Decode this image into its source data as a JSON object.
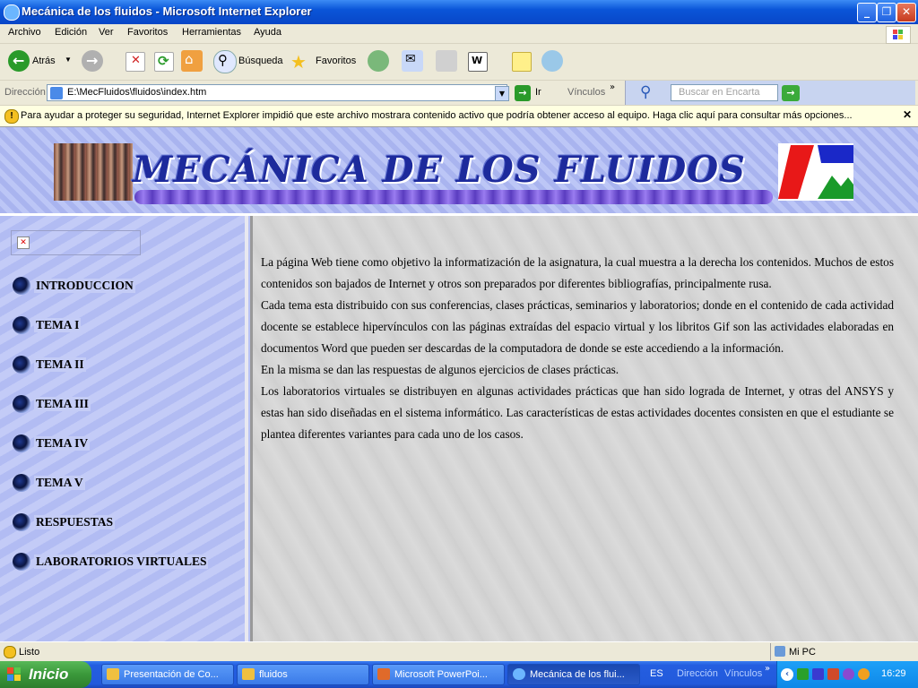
{
  "window": {
    "title": "Mecánica de los fluidos - Microsoft Internet Explorer"
  },
  "menu": [
    "Archivo",
    "Edición",
    "Ver",
    "Favoritos",
    "Herramientas",
    "Ayuda"
  ],
  "toolbar": {
    "back": "Atrás",
    "search": "Búsqueda",
    "favorites": "Favoritos"
  },
  "address": {
    "label": "Dirección",
    "value": "E:\\MecFluidos\\fluidos\\index.htm",
    "go": "Ir",
    "links": "Vínculos",
    "search_placeholder": "Buscar en Encarta"
  },
  "infobar": {
    "text": "Para ayudar a proteger su seguridad, Internet Explorer impidió que este archivo mostrara contenido activo que podría obtener acceso al equipo. Haga clic aquí para consultar más opciones..."
  },
  "banner": {
    "title": "MECÁNICA DE LOS FLUIDOS"
  },
  "nav": [
    "INTRODUCCION",
    "TEMA I",
    "TEMA II",
    "TEMA III",
    "TEMA IV",
    "TEMA V",
    "RESPUESTAS",
    "LABORATORIOS VIRTUALES"
  ],
  "content": {
    "paragraphs": [
      "La página Web tiene como objetivo la informatización de la asignatura, la cual muestra a la derecha los contenidos. Muchos de estos contenidos son bajados de Internet y otros son preparados por diferentes bibliografías, principalmente rusa.",
      "Cada tema esta distribuido con sus conferencias, clases prácticas, seminarios y laboratorios; donde en el contenido de cada actividad docente se establece hipervínculos con las páginas extraídas del espacio virtual y los libritos Gif son las actividades elaboradas en documentos Word que pueden ser descardas de la computadora de donde se este accediendo a la información.",
      "En la misma se dan las respuestas de algunos ejercicios de clases prácticas.",
      "Los laboratorios virtuales se distribuyen en algunas actividades prácticas que han sido lograda de Internet, y otras del ANSYS y estas han sido diseñadas en el sistema informático. Las características de estas actividades docentes consisten en que el estudiante se plantea diferentes variantes para cada uno de los casos."
    ]
  },
  "status": {
    "left": "Listo",
    "zone": "Mi PC"
  },
  "taskbar": {
    "start": "Inicio",
    "tasks": [
      "Presentación de Co...",
      "fluidos",
      "Microsoft PowerPoi...",
      "Mecánica de los flui..."
    ],
    "lang": "ES",
    "dir": "Dirección",
    "links": "Vínculos",
    "clock": "16:29"
  },
  "colors": {
    "titlebar": "#0a55d8",
    "page_bg": "#b8c2f4",
    "content_bg": "#d4d4d4",
    "taskbar": "#245ee0",
    "start": "#3a983a"
  }
}
